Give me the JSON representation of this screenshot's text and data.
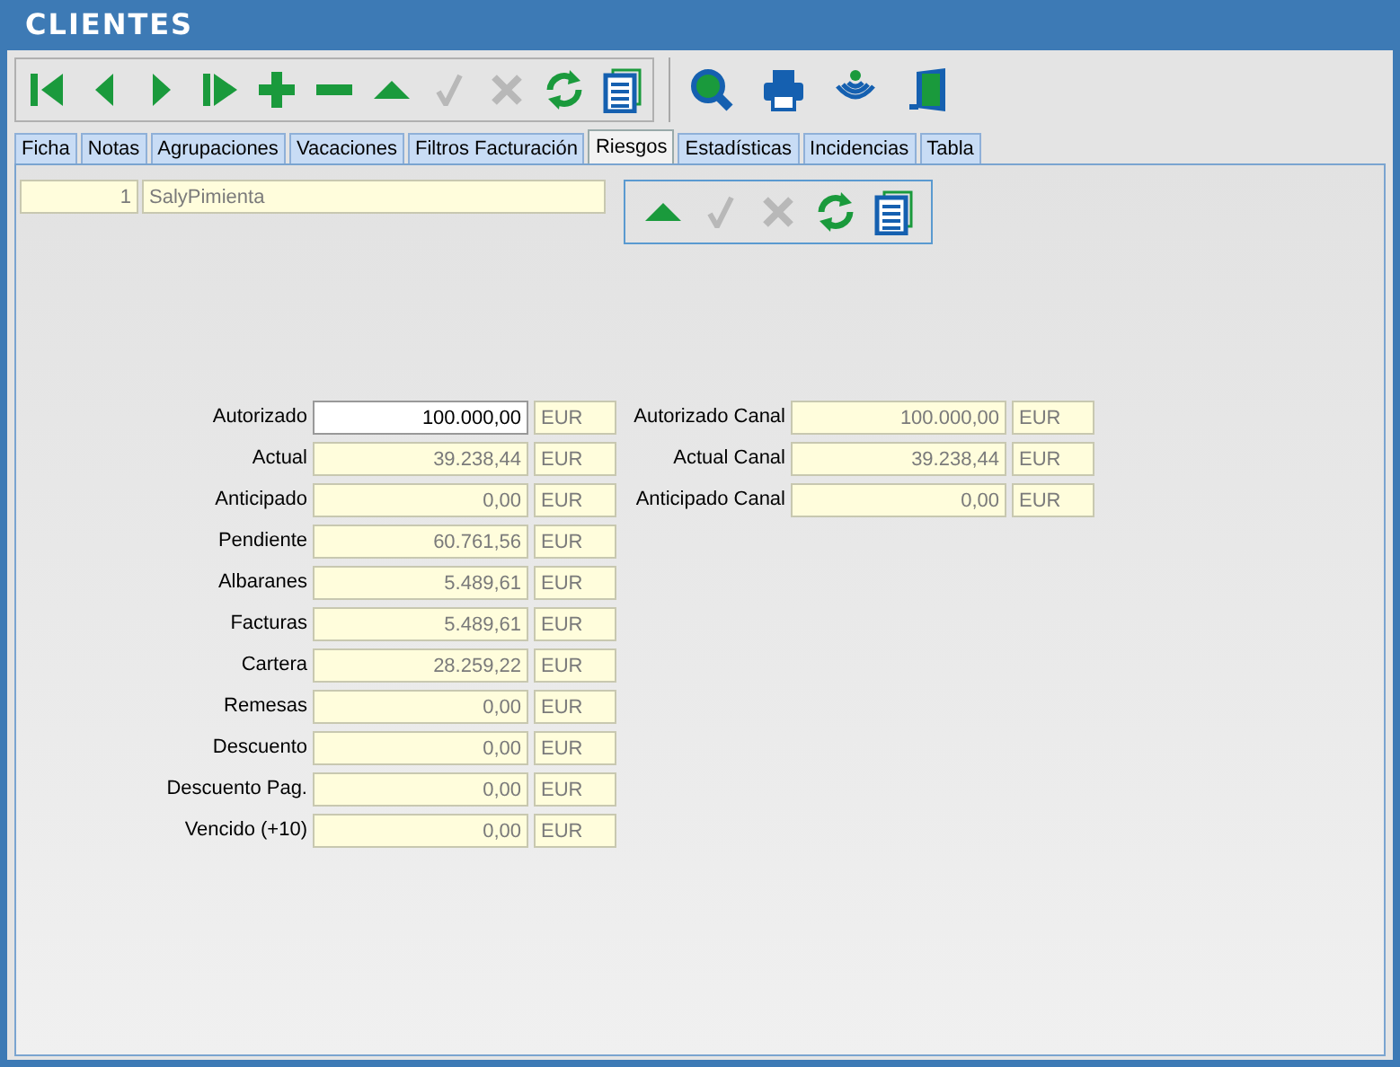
{
  "window": {
    "title": "CLIENTES"
  },
  "toolbar": [
    {
      "kind": "first",
      "disabled": false
    },
    {
      "kind": "prev",
      "disabled": false
    },
    {
      "kind": "next",
      "disabled": false
    },
    {
      "kind": "last",
      "disabled": false
    },
    {
      "kind": "add",
      "disabled": false
    },
    {
      "kind": "remove",
      "disabled": false
    },
    {
      "kind": "up",
      "disabled": false
    },
    {
      "kind": "accept",
      "disabled": true
    },
    {
      "kind": "cancel",
      "disabled": true
    },
    {
      "kind": "refresh",
      "disabled": false
    },
    {
      "kind": "list",
      "disabled": false
    }
  ],
  "toolbar_extra": [
    {
      "kind": "search"
    },
    {
      "kind": "print"
    },
    {
      "kind": "signal"
    },
    {
      "kind": "exit"
    }
  ],
  "tabs": [
    {
      "label": "Ficha",
      "selected": false
    },
    {
      "label": "Notas",
      "selected": false
    },
    {
      "label": "Agrupaciones",
      "selected": false
    },
    {
      "label": "Vacaciones",
      "selected": false
    },
    {
      "label": "Filtros Facturación",
      "selected": false
    },
    {
      "label": "Riesgos",
      "selected": true
    },
    {
      "label": "Estadísticas",
      "selected": false
    },
    {
      "label": "Incidencias",
      "selected": false
    },
    {
      "label": "Tabla",
      "selected": false
    }
  ],
  "client": {
    "code": "1",
    "name": "SalyPimienta"
  },
  "panel_toolbar": [
    {
      "kind": "up",
      "disabled": false
    },
    {
      "kind": "accept",
      "disabled": true
    },
    {
      "kind": "cancel",
      "disabled": true
    },
    {
      "kind": "refresh",
      "disabled": false
    },
    {
      "kind": "list",
      "disabled": false
    }
  ],
  "risk_fields": [
    {
      "label": "Autorizado",
      "value": "100.000,00",
      "unit": "EUR",
      "editable": true
    },
    {
      "label": "Actual",
      "value": "39.238,44",
      "unit": "EUR",
      "editable": false
    },
    {
      "label": "Anticipado",
      "value": "0,00",
      "unit": "EUR",
      "editable": false
    },
    {
      "label": "Pendiente",
      "value": "60.761,56",
      "unit": "EUR",
      "editable": false
    },
    {
      "label": "Albaranes",
      "value": "5.489,61",
      "unit": "EUR",
      "editable": false
    },
    {
      "label": "Facturas",
      "value": "5.489,61",
      "unit": "EUR",
      "editable": false
    },
    {
      "label": "Cartera",
      "value": "28.259,22",
      "unit": "EUR",
      "editable": false
    },
    {
      "label": "Remesas",
      "value": "0,00",
      "unit": "EUR",
      "editable": false
    },
    {
      "label": "Descuento",
      "value": "0,00",
      "unit": "EUR",
      "editable": false
    },
    {
      "label": "Descuento Pag.",
      "value": "0,00",
      "unit": "EUR",
      "editable": false
    },
    {
      "label": "Vencido (+10)",
      "value": "0,00",
      "unit": "EUR",
      "editable": false
    }
  ],
  "channel_fields": [
    {
      "label": "Autorizado Canal",
      "value": "100.000,00",
      "unit": "EUR",
      "editable": false
    },
    {
      "label": "Actual Canal",
      "value": "39.238,44",
      "unit": "EUR",
      "editable": false
    },
    {
      "label": "Anticipado Canal",
      "value": "0,00",
      "unit": "EUR",
      "editable": false
    }
  ]
}
